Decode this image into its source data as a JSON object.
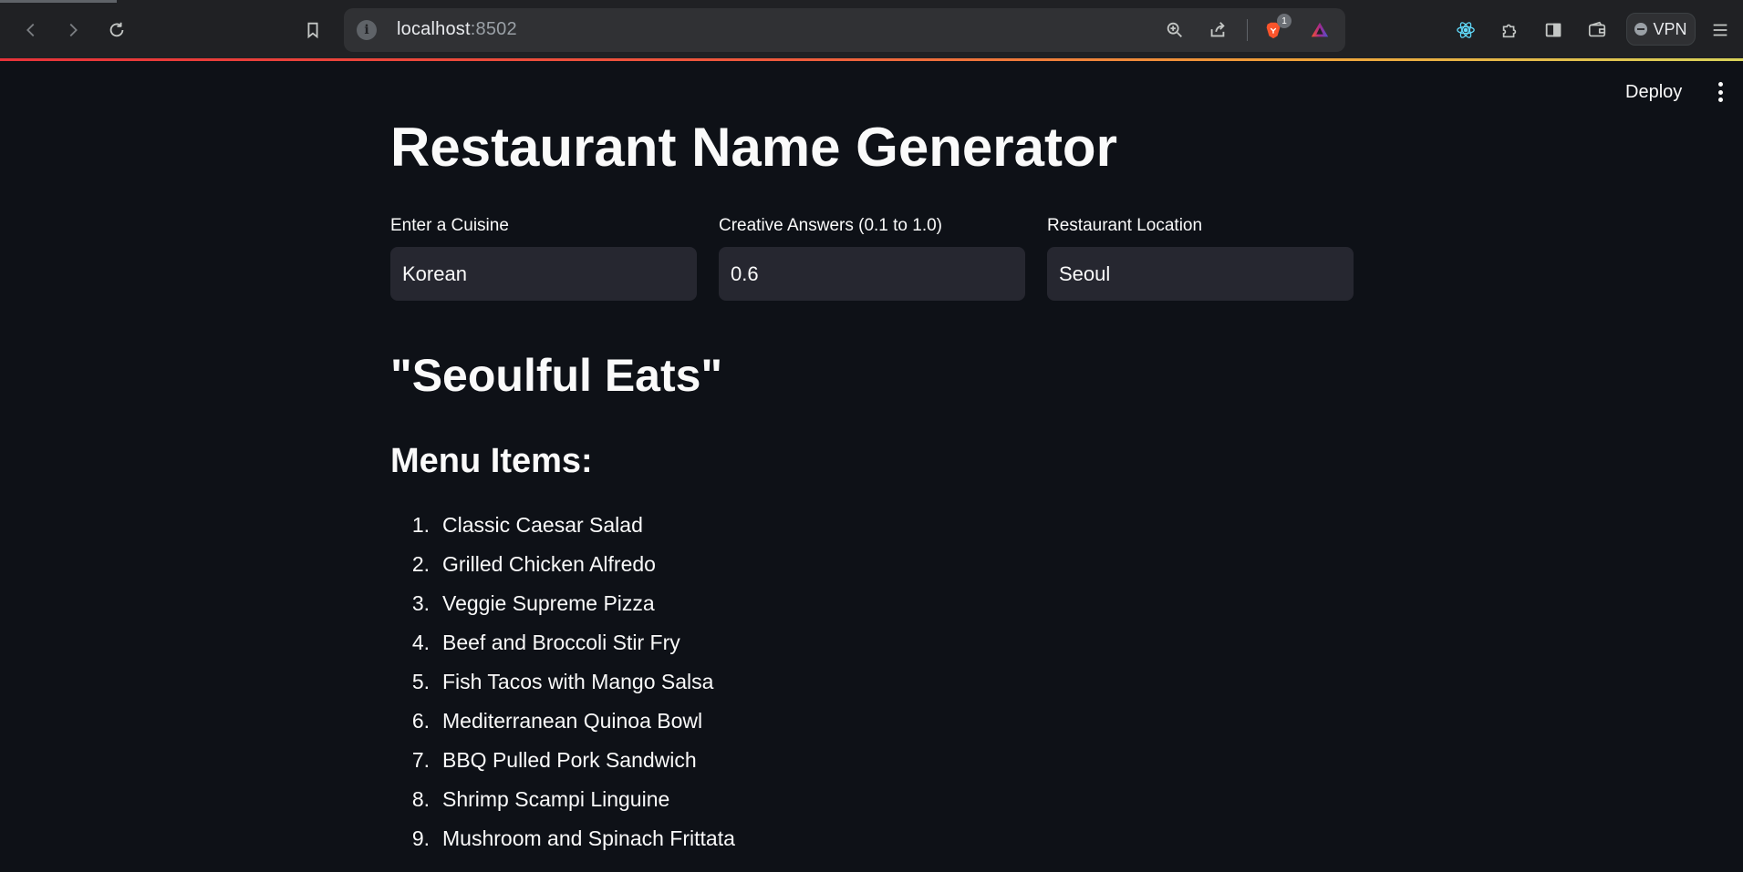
{
  "browser": {
    "url_host": "localhost",
    "url_port": ":8502",
    "brave_badge_count": "1",
    "vpn_label": "VPN"
  },
  "app": {
    "deploy_label": "Deploy",
    "title": "Restaurant Name Generator",
    "inputs": [
      {
        "label": "Enter a Cuisine",
        "value": "Korean"
      },
      {
        "label": "Creative Answers (0.1 to 1.0)",
        "value": "0.6"
      },
      {
        "label": "Restaurant Location",
        "value": "Seoul"
      }
    ],
    "restaurant_name": "\"Seoulful Eats\"",
    "menu_heading": "Menu Items:",
    "menu_items": [
      {
        "num": "1.",
        "text": "Classic Caesar Salad"
      },
      {
        "num": "2.",
        "text": "Grilled Chicken Alfredo"
      },
      {
        "num": "3.",
        "text": "Veggie Supreme Pizza"
      },
      {
        "num": "4.",
        "text": "Beef and Broccoli Stir Fry"
      },
      {
        "num": "5.",
        "text": "Fish Tacos with Mango Salsa"
      },
      {
        "num": "6.",
        "text": "Mediterranean Quinoa Bowl"
      },
      {
        "num": "7.",
        "text": "BBQ Pulled Pork Sandwich"
      },
      {
        "num": "8.",
        "text": "Shrimp Scampi Linguine"
      },
      {
        "num": "9.",
        "text": "Mushroom and Spinach Frittata"
      }
    ]
  },
  "colors": {
    "background": "#0e1117",
    "input_background": "#262730",
    "chrome_background": "#202124",
    "accent_gradient_start": "#e8333a",
    "accent_gradient_end": "#d9d35a"
  }
}
